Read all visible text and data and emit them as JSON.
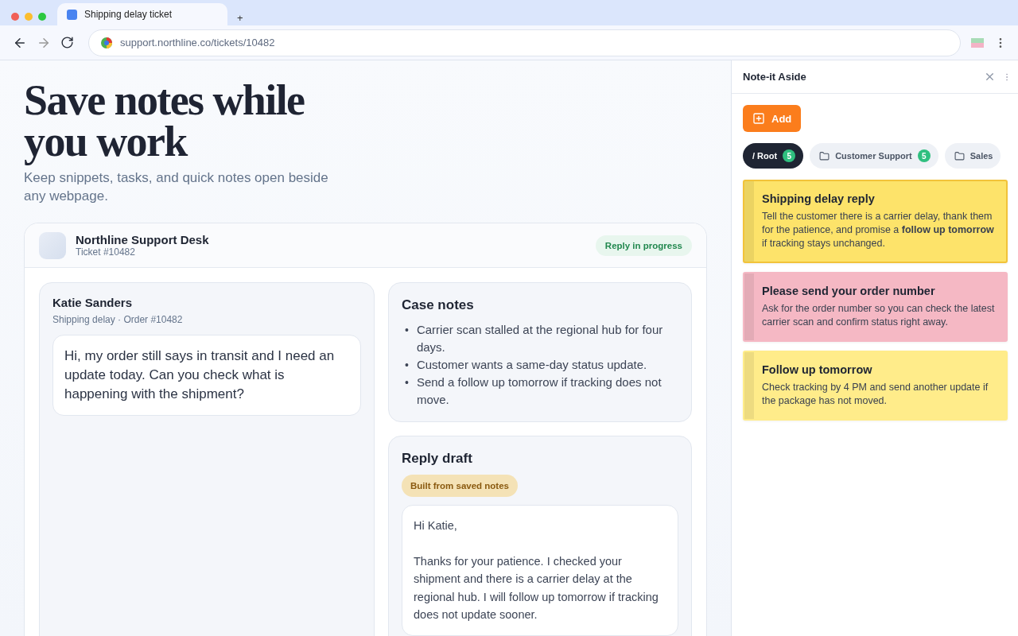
{
  "browser": {
    "tab_title": "Shipping delay ticket",
    "new_tab": "+",
    "url": "support.northline.co/tickets/10482"
  },
  "hero": {
    "title": "Save notes while you work",
    "subtitle": "Keep snippets, tasks, and quick notes open beside any webpage."
  },
  "ticket": {
    "desk": "Northline Support Desk",
    "number": "Ticket #10482",
    "status": "Reply in progress",
    "customer": {
      "name": "Katie Sanders",
      "meta": "Shipping delay · Order #10482",
      "message": "Hi, my order still says in transit and I need an update today. Can you check what is happening with the shipment?"
    },
    "case_notes": {
      "title": "Case notes",
      "bullet": "•",
      "items": [
        "Carrier scan stalled at the regional hub for four days.",
        "Customer wants a same-day status update.",
        "Send a follow up tomorrow if tracking does not move."
      ]
    },
    "reply": {
      "title": "Reply draft",
      "badge": "Built from saved notes",
      "paragraphs": [
        "Hi Katie,",
        "Thanks for your patience. I checked your shipment and there is a carrier delay at the regional hub. I will follow up tomorrow if tracking does not update sooner."
      ]
    }
  },
  "panel": {
    "title": "Note-it Aside",
    "add_button": "Add",
    "folders": [
      {
        "kind": "root",
        "label": "/ Root",
        "count": "5",
        "selected": true
      },
      {
        "kind": "folder",
        "label": "Customer Support",
        "count": "5",
        "selected": false
      },
      {
        "kind": "folder",
        "label": "Sales",
        "selected": false
      }
    ],
    "notes": [
      {
        "title": "Shipping delay reply",
        "body": "Tell the customer there is a carrier delay, thank them for the patience, and promise a **follow up tomorrow** if tracking stays unchanged.",
        "color": "#fde36a",
        "selected": true
      },
      {
        "title": "Please send your order number",
        "body": "Ask for the order number so you can check the latest carrier scan and confirm status right away.",
        "color": "#f5b8c4",
        "selected": false
      },
      {
        "title": "Follow up tomorrow",
        "body": "Check tracking by 4 PM and send another update if the package has not moved.",
        "color": "#ffec8a",
        "selected": false
      }
    ]
  }
}
